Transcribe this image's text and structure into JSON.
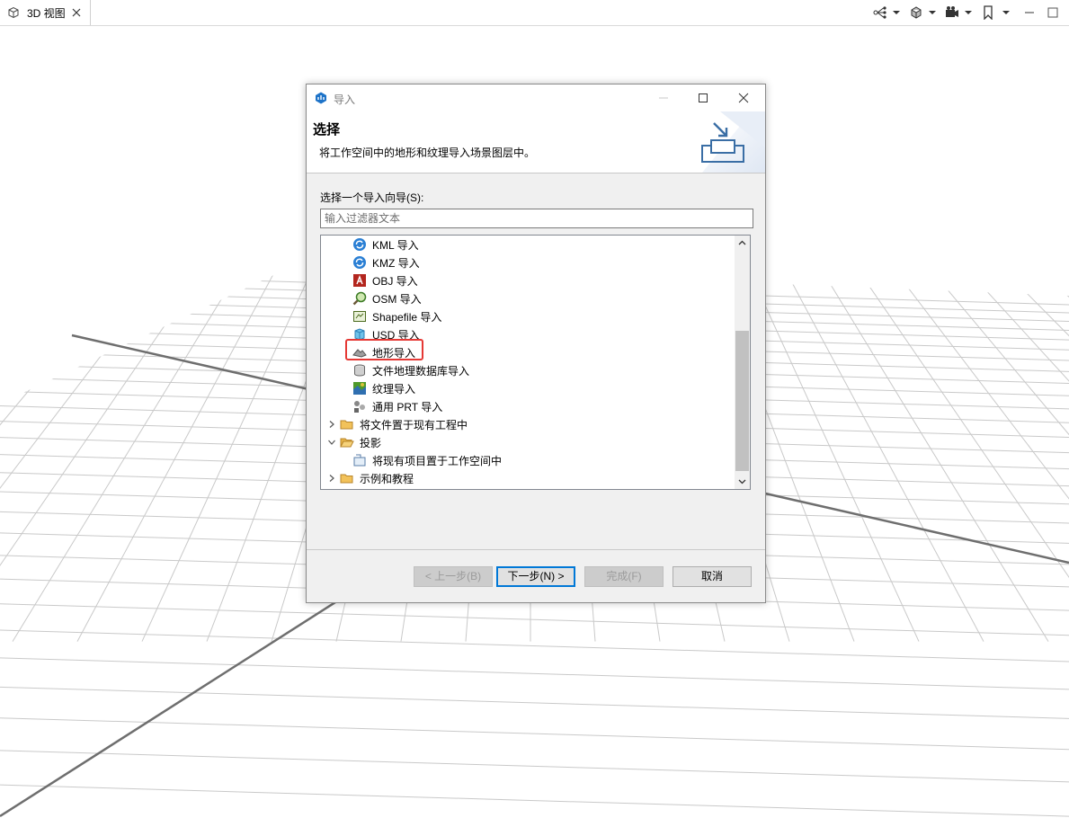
{
  "tab": {
    "label": "3D 视图"
  },
  "dialog": {
    "title": "导入",
    "header_title": "选择",
    "header_desc": "将工作空间中的地形和纹理导入场景图层中。",
    "select_label": "选择一个导入向导(S):",
    "filter_placeholder": "输入过滤器文本",
    "tree": [
      {
        "label": "KML 导入",
        "icon": "kml-icon"
      },
      {
        "label": "KMZ 导入",
        "icon": "kmz-icon"
      },
      {
        "label": "OBJ 导入",
        "icon": "obj-icon"
      },
      {
        "label": "OSM 导入",
        "icon": "osm-icon"
      },
      {
        "label": "Shapefile 导入",
        "icon": "shapefile-icon"
      },
      {
        "label": "USD 导入",
        "icon": "usd-icon"
      },
      {
        "label": "地形导入",
        "icon": "terrain-icon",
        "highlighted": true
      },
      {
        "label": "文件地理数据库导入",
        "icon": "geodatabase-icon"
      },
      {
        "label": "纹理导入",
        "icon": "texture-icon"
      },
      {
        "label": "通用 PRT 导入",
        "icon": "prt-icon"
      },
      {
        "label": "将文件置于现有工程中",
        "icon": "folder-icon",
        "state": "collapsed"
      },
      {
        "label": "投影",
        "icon": "folder-open-icon",
        "state": "expanded"
      },
      {
        "label": "将现有项目置于工作空间中",
        "icon": "project-icon"
      },
      {
        "label": "示例和教程",
        "icon": "folder-icon",
        "state": "collapsed"
      }
    ],
    "buttons": {
      "back": "< 上一步(B)",
      "next": "下一步(N) >",
      "finish": "完成(F)",
      "cancel": "取消"
    }
  },
  "colors": {
    "highlight": "#e53935",
    "primary_border": "#0078d7",
    "dialog_bg": "#f0f0f0"
  }
}
